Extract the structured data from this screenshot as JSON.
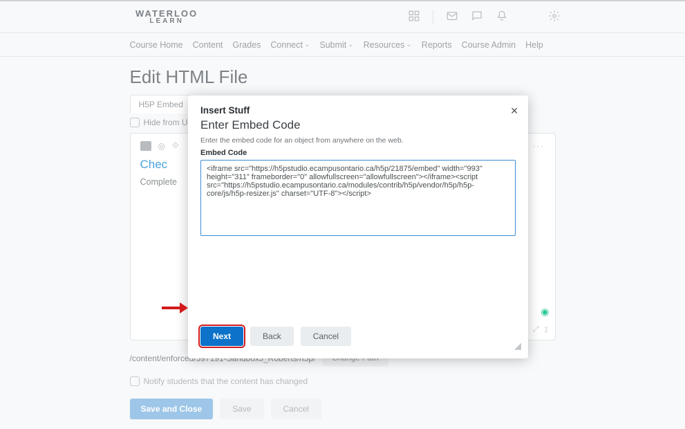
{
  "brand": {
    "line1": "WATERLOO",
    "line2": "LEARN"
  },
  "nav": {
    "items": [
      "Course Home",
      "Content",
      "Grades",
      "Connect",
      "Submit",
      "Resources",
      "Reports",
      "Course Admin",
      "Help"
    ],
    "dropdown_flags": [
      false,
      false,
      false,
      true,
      true,
      true,
      false,
      false,
      false
    ]
  },
  "page": {
    "title": "Edit HTML File",
    "tab": "H5P Embed",
    "hide_from_users": "Hide from U",
    "doc_title": "Chec",
    "doc_body": "Complete",
    "toolbar_dots": "···",
    "path": "/content/enforced/397191-SandboxJ_Roberts/h5p/",
    "change_path": "Change Path",
    "notify": "Notify students that the content has changed",
    "save_close": "Save and Close",
    "save": "Save",
    "cancel": "Cancel"
  },
  "modal": {
    "title": "Insert Stuff",
    "subtitle": "Enter Embed Code",
    "hint": "Enter the embed code for an object from anywhere on the web.",
    "label": "Embed Code",
    "textarea_value": "<iframe src=\"https://h5pstudio.ecampusontario.ca/h5p/21875/embed\" width=\"993\" height=\"311\" frameborder=\"0\" allowfullscreen=\"allowfullscreen\"></iframe><script src=\"https://h5pstudio.ecampusontario.ca/modules/contrib/h5p/vendor/h5p/h5p-core/js/h5p-resizer.js\" charset=\"UTF-8\"></​script>",
    "next": "Next",
    "back": "Back",
    "cancel": "Cancel"
  },
  "icons": {
    "grid": "grid-icon",
    "mail": "mail-icon",
    "chat": "chat-icon",
    "bell": "bell-icon",
    "gear": "gear-icon"
  }
}
